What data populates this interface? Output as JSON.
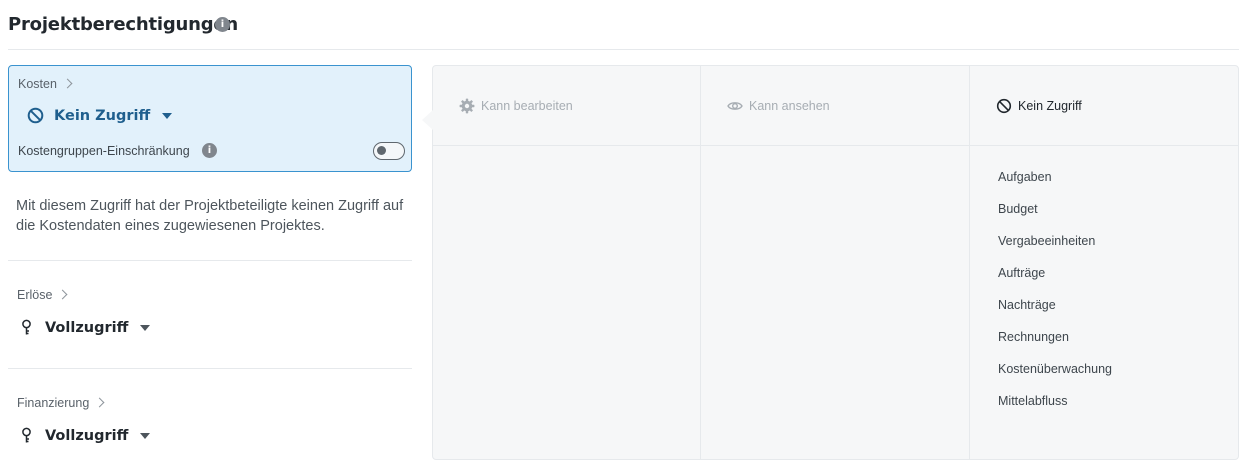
{
  "header": {
    "title": "Projektberechtigungen",
    "info_icon": "info-icon"
  },
  "costs_card": {
    "label": "Kosten",
    "access_value": "Kein Zugriff",
    "access_icon": "no-access-icon",
    "restriction_label": "Kostengruppen-Einschränkung",
    "restriction_enabled": false,
    "accent": "#1f5f8e",
    "background": "#e2f1fb",
    "border": "#3a93cf"
  },
  "description": "Mit diesem Zugriff hat der Projektbeteiligte keinen Zugriff auf die Kostendaten eines zugewiesenen Projektes.",
  "sections": [
    {
      "label": "Erlöse",
      "access_value": "Vollzugriff",
      "icon": "key-icon"
    },
    {
      "label": "Finanzierung",
      "access_value": "Vollzugriff",
      "icon": "key-icon"
    }
  ],
  "permission_columns": [
    {
      "label": "Kann bearbeiten",
      "icon": "gear-icon",
      "active": false
    },
    {
      "label": "Kann ansehen",
      "icon": "eye-icon",
      "active": false
    },
    {
      "label": "Kein Zugriff",
      "icon": "no-access-icon",
      "active": true
    }
  ],
  "no_access_items": [
    "Aufgaben",
    "Budget",
    "Vergabeeinheiten",
    "Aufträge",
    "Nachträge",
    "Rechnungen",
    "Kostenüberwachung",
    "Mittelabfluss"
  ]
}
